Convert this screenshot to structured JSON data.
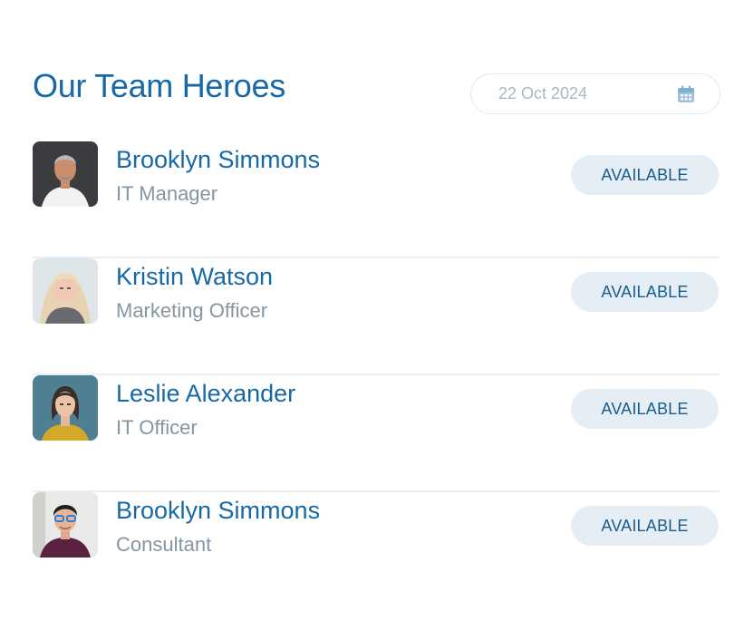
{
  "header": {
    "title": "Our Team Heroes",
    "date_value": "22 Oct 2024",
    "date_icon": "calendar-icon"
  },
  "colors": {
    "accent": "#1668a6",
    "muted_text": "#8495a3",
    "badge_bg": "#e5eef5",
    "badge_text": "#1a5d8c",
    "divider": "#e8eff5"
  },
  "members": [
    {
      "name": "Brooklyn Simmons",
      "role": "IT Manager",
      "status": "AVAILABLE",
      "avatar": "photo-man-grey-hair"
    },
    {
      "name": "Kristin Watson",
      "role": "Marketing Officer",
      "status": "AVAILABLE",
      "avatar": "photo-woman-blonde"
    },
    {
      "name": "Leslie Alexander",
      "role": "IT Officer",
      "status": "AVAILABLE",
      "avatar": "photo-woman-dark-hair"
    },
    {
      "name": "Brooklyn Simmons",
      "role": "Consultant",
      "status": "AVAILABLE",
      "avatar": "photo-man-glasses"
    }
  ]
}
